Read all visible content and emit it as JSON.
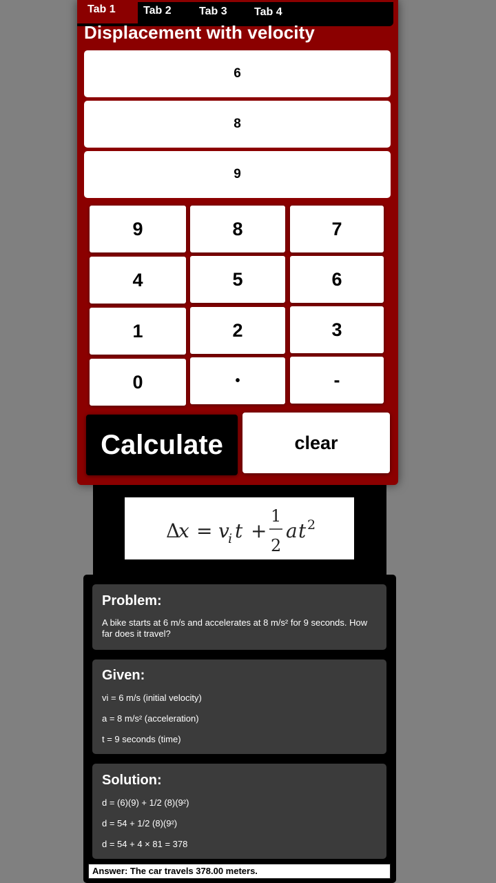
{
  "tabs": [
    {
      "label": "Tab 1",
      "active": true
    },
    {
      "label": "Tab 2",
      "active": false
    },
    {
      "label": "Tab 3",
      "active": false
    },
    {
      "label": "Tab 4",
      "active": false
    }
  ],
  "title": "Displacement with velocity",
  "inputs": [
    "6",
    "8",
    "9"
  ],
  "keypad": [
    "9",
    "8",
    "7",
    "4",
    "5",
    "6",
    "1",
    "2",
    "3",
    "0",
    "•",
    "-"
  ],
  "buttons": {
    "calculate": "Calculate",
    "clear": "clear"
  },
  "formula": "Δx = v_i t + ½ a t²",
  "problem": {
    "heading": "Problem:",
    "text": "A bike starts at 6 m/s and accelerates at 8 m/s² for 9 seconds. How far does it travel?"
  },
  "given": {
    "heading": "Given:",
    "lines": [
      "vi = 6 m/s (initial velocity)",
      "a = 8 m/s² (acceleration)",
      "t = 9 seconds (time)"
    ]
  },
  "solution": {
    "heading": "Solution:",
    "lines": [
      "d = (6)(9) + 1/2 (8)(9²)",
      "d = 54 + 1/2 (8)(9²)",
      "d = 54 + 4 × 81 = 378"
    ]
  },
  "answer": "Answer: The car travels 378.00 meters.",
  "colors": {
    "panel": "#8b0000",
    "background": "#808080",
    "card": "#3b3b3b"
  }
}
